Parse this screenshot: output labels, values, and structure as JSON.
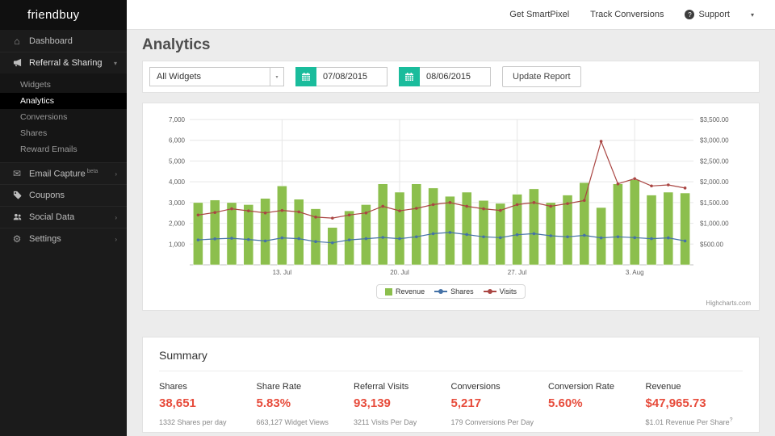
{
  "app": {
    "logo": "friendbuy"
  },
  "topbar": {
    "links": [
      {
        "label": "Get SmartPixel"
      },
      {
        "label": "Track Conversions"
      }
    ],
    "support_label": "Support"
  },
  "sidebar": {
    "dashboard": "Dashboard",
    "referral_sharing": "Referral & Sharing",
    "sub_items": [
      "Widgets",
      "Analytics",
      "Conversions",
      "Shares",
      "Reward Emails"
    ],
    "active_sub_item": "Analytics",
    "email_capture": "Email Capture",
    "email_capture_badge": "beta",
    "coupons": "Coupons",
    "social_data": "Social Data",
    "settings": "Settings"
  },
  "page": {
    "title": "Analytics"
  },
  "filters": {
    "widget_select_value": "All Widgets",
    "date_from": "07/08/2015",
    "date_to": "08/06/2015",
    "update_button": "Update Report"
  },
  "chart_data": {
    "type": "combo",
    "categories": [
      "Jul 8",
      "Jul 9",
      "Jul 10",
      "Jul 11",
      "Jul 12",
      "Jul 13",
      "Jul 14",
      "Jul 15",
      "Jul 16",
      "Jul 17",
      "Jul 18",
      "Jul 19",
      "Jul 20",
      "Jul 21",
      "Jul 22",
      "Jul 23",
      "Jul 24",
      "Jul 25",
      "Jul 26",
      "Jul 27",
      "Jul 28",
      "Jul 29",
      "Jul 30",
      "Jul 31",
      "Aug 1",
      "Aug 2",
      "Aug 3",
      "Aug 4",
      "Aug 5",
      "Aug 6"
    ],
    "x_ticks": [
      {
        "index": 5,
        "label": "13. Jul"
      },
      {
        "index": 12,
        "label": "20. Jul"
      },
      {
        "index": 19,
        "label": "27. Jul"
      },
      {
        "index": 26,
        "label": "3. Aug"
      }
    ],
    "left_axis": {
      "min": 0,
      "max": 7000,
      "ticks": [
        1000,
        2000,
        3000,
        4000,
        5000,
        6000,
        7000
      ],
      "tick_labels": [
        "1,000",
        "2,000",
        "3,000",
        "4,000",
        "5,000",
        "6,000",
        "7,000"
      ]
    },
    "right_axis": {
      "min": 0,
      "max": 3500,
      "ticks": [
        500,
        1000,
        1500,
        2000,
        2500,
        3000,
        3500
      ],
      "tick_labels": [
        "$500.00",
        "$1,000.00",
        "$1,500.00",
        "$2,000.00",
        "$2,500.00",
        "$3,000.00",
        "$3,500.00"
      ]
    },
    "series": [
      {
        "name": "Revenue",
        "type": "bar",
        "axis": "right",
        "color": "#8CBF4D",
        "values": [
          1500,
          1560,
          1500,
          1450,
          1600,
          1900,
          1580,
          1350,
          900,
          1300,
          1450,
          1950,
          1750,
          1950,
          1850,
          1650,
          1750,
          1550,
          1480,
          1700,
          1830,
          1500,
          1680,
          1980,
          1380,
          1950,
          2050,
          1680,
          1750,
          1730
        ]
      },
      {
        "name": "Shares",
        "type": "line",
        "axis": "left",
        "color": "#4572A7",
        "values": [
          1200,
          1250,
          1280,
          1220,
          1150,
          1300,
          1260,
          1120,
          1060,
          1200,
          1260,
          1320,
          1260,
          1350,
          1500,
          1560,
          1460,
          1350,
          1310,
          1450,
          1500,
          1400,
          1350,
          1420,
          1300,
          1350,
          1310,
          1260,
          1300,
          1150
        ]
      },
      {
        "name": "Visits",
        "type": "line",
        "axis": "left",
        "color": "#AA4643",
        "values": [
          2400,
          2520,
          2700,
          2600,
          2500,
          2620,
          2550,
          2300,
          2250,
          2400,
          2500,
          2820,
          2600,
          2720,
          2900,
          3000,
          2820,
          2700,
          2620,
          2900,
          3000,
          2820,
          2950,
          3100,
          5950,
          3900,
          4150,
          3800,
          3850,
          3700
        ]
      }
    ],
    "grid": true,
    "legend_position": "bottom",
    "credit": "Highcharts.com"
  },
  "summary": {
    "title": "Summary",
    "stats": [
      {
        "label": "Shares",
        "value": "38,651",
        "sub": "1332 Shares per day",
        "sup": ""
      },
      {
        "label": "Share Rate",
        "value": "5.83%",
        "sub": "663,127 Widget Views",
        "sup": ""
      },
      {
        "label": "Referral Visits",
        "value": "93,139",
        "sub": "3211 Visits Per Day",
        "sup": ""
      },
      {
        "label": "Conversions",
        "value": "5,217",
        "sub": "179 Conversions Per Day",
        "sup": ""
      },
      {
        "label": "Conversion Rate",
        "value": "5.60%",
        "sub": "",
        "sup": ""
      },
      {
        "label": "Revenue",
        "value": "$47,965.73",
        "sub": "$1.01 Revenue Per Share",
        "sup": "?"
      }
    ]
  },
  "colors": {
    "accent_teal": "#1abc9c",
    "stat_red": "#e74c3c",
    "bar_green": "#8CBF4D",
    "line_blue": "#4572A7",
    "line_red": "#AA4643",
    "sidebar_bg": "#1b1b1b"
  }
}
